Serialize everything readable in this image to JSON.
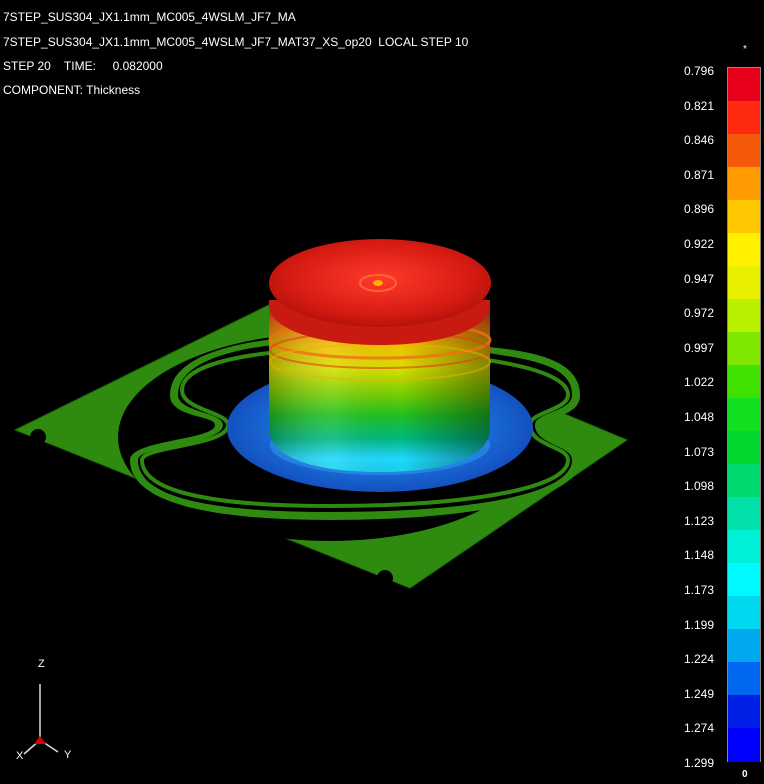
{
  "header": {
    "line1": "7STEP_SUS304_JX1.1mm_MC005_4WSLM_JF7_MA",
    "line2": "7STEP_SUS304_JX1.1mm_MC005_4WSLM_JF7_MAT37_XS_op20  LOCAL STEP 10",
    "line3": "STEP 20    TIME:     0.082000",
    "line4": "COMPONENT: Thickness"
  },
  "legend": {
    "top_mark": "*",
    "bottom_mark": "0",
    "values": [
      "0.796",
      "0.821",
      "0.846",
      "0.871",
      "0.896",
      "0.922",
      "0.947",
      "0.972",
      "0.997",
      "1.022",
      "1.048",
      "1.073",
      "1.098",
      "1.123",
      "1.148",
      "1.173",
      "1.199",
      "1.224",
      "1.249",
      "1.274",
      "1.299"
    ],
    "colors": [
      "#e8001a",
      "#ff2a10",
      "#f55a0a",
      "#ff9a00",
      "#ffc800",
      "#fff000",
      "#e8f000",
      "#b8f000",
      "#80e800",
      "#40e000",
      "#10e020",
      "#00d830",
      "#00d870",
      "#00e0a8",
      "#00f0d8",
      "#00f8ff",
      "#00d8f0",
      "#00a8f0",
      "#0068f0",
      "#0020e8",
      "#0000ff"
    ]
  },
  "triad": {
    "z_label": "Z",
    "x_label": "X",
    "y_label": "Y"
  },
  "model": {
    "sheet_color": "#2f8a10",
    "dome_color": "#d41a12",
    "flange_color": "#1a64d0"
  }
}
